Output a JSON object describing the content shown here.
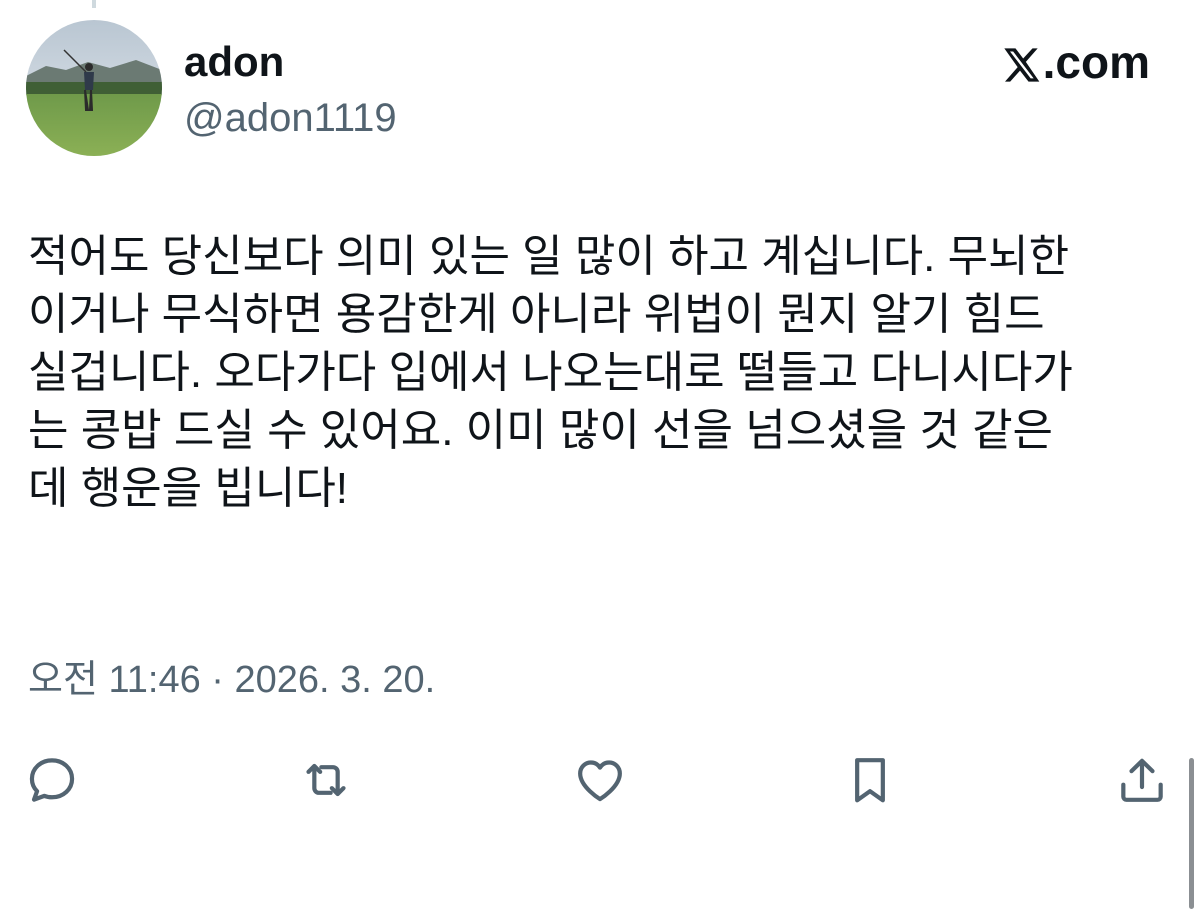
{
  "author": {
    "display_name": "adon",
    "handle": "@adon1119"
  },
  "brand": {
    "text": ".com",
    "icon": "x-logo-icon"
  },
  "tweet": {
    "lines": [
      "적어도 당신보다 의미 있는 일 많이 하고 계십니다. 무뇌한",
      "이거나 무식하면 용감한게 아니라 위법이 뭔지 알기 힘드",
      "실겁니다. 오다가다 입에서 나오는대로 떨들고 다니시다가",
      "는 콩밥 드실 수 있어요. 이미 많이 선을 넘으셨을 것 같은",
      "데 행운을 빕니다!"
    ],
    "timestamp": "오전 11:46 · 2026. 3. 20."
  },
  "actions": [
    {
      "name": "reply",
      "icon": "reply-icon"
    },
    {
      "name": "retweet",
      "icon": "retweet-icon"
    },
    {
      "name": "like",
      "icon": "heart-icon"
    },
    {
      "name": "bookmark",
      "icon": "bookmark-icon"
    },
    {
      "name": "share",
      "icon": "share-icon"
    }
  ],
  "colors": {
    "text_primary": "#0f1419",
    "text_secondary": "#536471"
  }
}
